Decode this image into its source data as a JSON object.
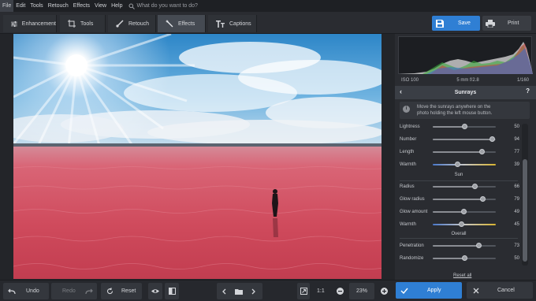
{
  "menu": {
    "items": [
      "File",
      "Edit",
      "Tools",
      "Retouch",
      "Effects",
      "View",
      "Help"
    ],
    "search_placeholder": "What do you want to do?"
  },
  "tabs": [
    {
      "label": "Enhancement",
      "icon": "sliders-icon"
    },
    {
      "label": "Tools",
      "icon": "crop-icon"
    },
    {
      "label": "Retouch",
      "icon": "brush-icon"
    },
    {
      "label": "Effects",
      "icon": "magic-wand-icon",
      "active": true
    },
    {
      "label": "Captions",
      "icon": "text-icon"
    }
  ],
  "toolbar": {
    "save_label": "Save",
    "print_label": "Print"
  },
  "exif": {
    "iso": "ISO 100",
    "lens": "5 mm f/2.8",
    "shutter": "1/160"
  },
  "panel": {
    "title": "Sunrays",
    "help": "?",
    "hint_line1": "Move the sunrays anywhere on the",
    "hint_line2": "photo holding the left mouse button.",
    "sections": {
      "sun": "Sun",
      "overall": "Overall"
    },
    "reset_all": "Reset all"
  },
  "sliders": [
    {
      "label": "Lightness",
      "value": 50,
      "max": 100,
      "type": "normal"
    },
    {
      "label": "Number",
      "value": 94,
      "max": 100,
      "type": "normal"
    },
    {
      "label": "Length",
      "value": 77,
      "max": 100,
      "type": "normal"
    },
    {
      "label": "Warmth",
      "value": 39,
      "max": 100,
      "type": "warm"
    },
    {
      "label": "Radius",
      "value": 66,
      "max": 100,
      "type": "normal"
    },
    {
      "label": "Glow radius",
      "value": 79,
      "max": 100,
      "type": "normal"
    },
    {
      "label": "Glow amount",
      "value": 49,
      "max": 100,
      "type": "normal"
    },
    {
      "label": "Warmth",
      "value": 45,
      "max": 100,
      "type": "warm"
    },
    {
      "label": "Penetration",
      "value": 73,
      "max": 100,
      "type": "normal"
    },
    {
      "label": "Randomize",
      "value": 50,
      "max": 100,
      "type": "normal"
    }
  ],
  "bottom": {
    "undo": "Undo",
    "redo": "Redo",
    "reset": "Reset",
    "zoom_1to1": "1:1",
    "zoom_level": "23%",
    "apply": "Apply",
    "cancel": "Cancel"
  },
  "colors": {
    "accent": "#2f7fd4",
    "background": "#2a2c31"
  }
}
